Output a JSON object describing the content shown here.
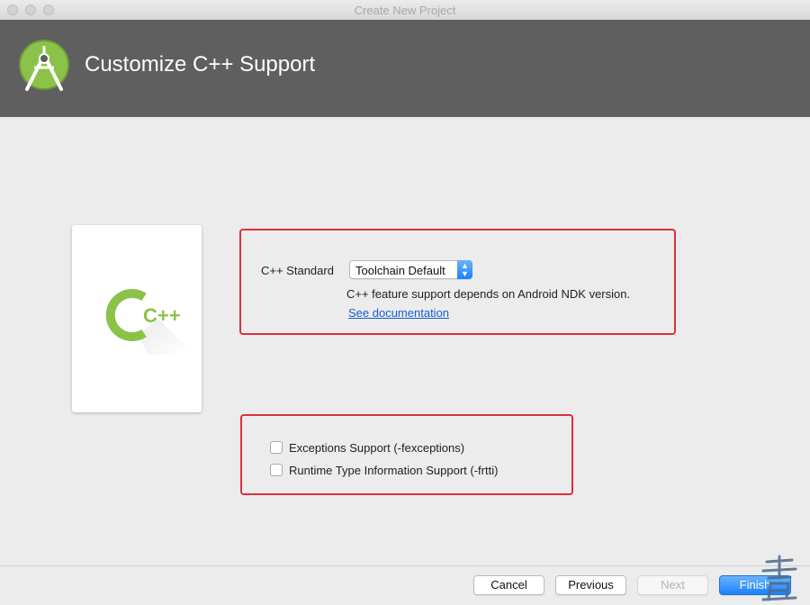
{
  "window": {
    "title": "Create New Project"
  },
  "header": {
    "title": "Customize C++ Support"
  },
  "preview": {
    "logo_text": "C++"
  },
  "cpp_standard": {
    "label": "C++ Standard",
    "selected_value": "Toolchain Default",
    "note": "C++ feature support depends on Android NDK version.",
    "doc_link": "See documentation"
  },
  "options": [
    {
      "label": "Exceptions Support (-fexceptions)",
      "checked": false
    },
    {
      "label": "Runtime Type Information Support (-frtti)",
      "checked": false
    }
  ],
  "footer": {
    "cancel": "Cancel",
    "previous": "Previous",
    "next": "Next",
    "finish": "Finish"
  },
  "colors": {
    "header_bg": "#5f5f5f",
    "android_green": "#8bc34a",
    "highlight_red": "#d8323a",
    "primary_blue": "#1a82fb"
  }
}
